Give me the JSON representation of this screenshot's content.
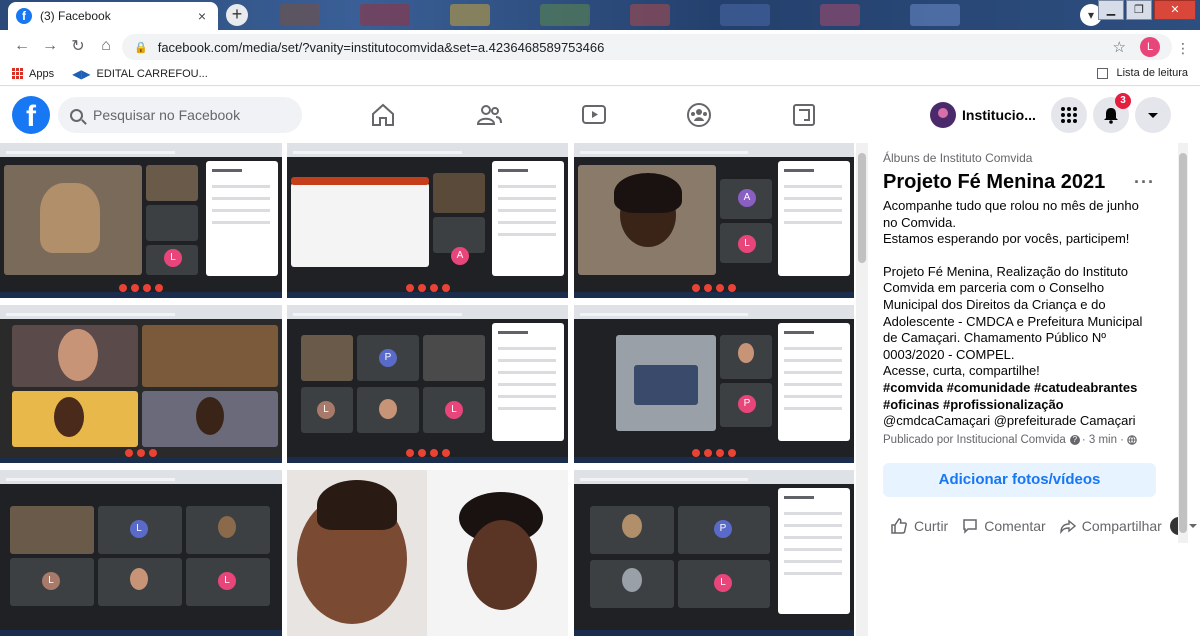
{
  "browser": {
    "tab_title": "(3) Facebook",
    "tab_close": "×",
    "new_tab": "+",
    "url": "facebook.com/media/set/?vanity=institutocomvida&set=a.4236468589753466",
    "profile_initial": "L",
    "bookmarks": [
      {
        "label": "Apps",
        "icon": "apps-grid-icon"
      },
      {
        "label": "EDITAL CARREFOU...",
        "icon": "carrefour-icon"
      }
    ],
    "reading_list": "Lista de leitura"
  },
  "facebook": {
    "search_placeholder": "Pesquisar no Facebook",
    "nav_icons": [
      "home-icon",
      "friends-icon",
      "watch-icon",
      "groups-icon",
      "gaming-icon"
    ],
    "page_name": "Institucio...",
    "notifications_count": "3"
  },
  "album": {
    "breadcrumb": "Álbuns de Instituto Comvida",
    "title": "Projeto Fé Menina 2021",
    "more": "···",
    "description_1": "Acompanhe tudo que rolou no mês de junho no Comvida.",
    "description_2": "Estamos esperando por vocês, participem!",
    "description_3": "Projeto Fé Menina, Realização do Instituto Comvida em parceria com o Conselho Municipal dos Direitos da Criança e do Adolescente - CMDCA e Prefeitura Municipal de Camaçari. Chamamento Público Nº 0003/2020 - COMPEL.",
    "description_4": "Acesse, curta, compartilhe!",
    "hashtags_1": "#comvida #comunidade #catudeabrantes",
    "hashtags_2": "#oficinas #profissionalização",
    "mentions": "@cmdcaCamaçari @prefeiturade Camaçari",
    "published_by": "Publicado por Institucional Comvida",
    "published_time": "· 3 min ·",
    "add_button": "Adicionar fotos/vídeos",
    "actions": {
      "like": "Curtir",
      "comment": "Comentar",
      "share": "Compartilhar"
    }
  },
  "photos": {
    "avatar_letters": [
      "L",
      "A",
      "L",
      "P",
      "L",
      "L",
      "P",
      "L",
      "L",
      "P",
      "L"
    ]
  },
  "colors": {
    "facebook_blue": "#1877f2",
    "notification_red": "#e41e3f",
    "meet_dark": "#202124"
  }
}
